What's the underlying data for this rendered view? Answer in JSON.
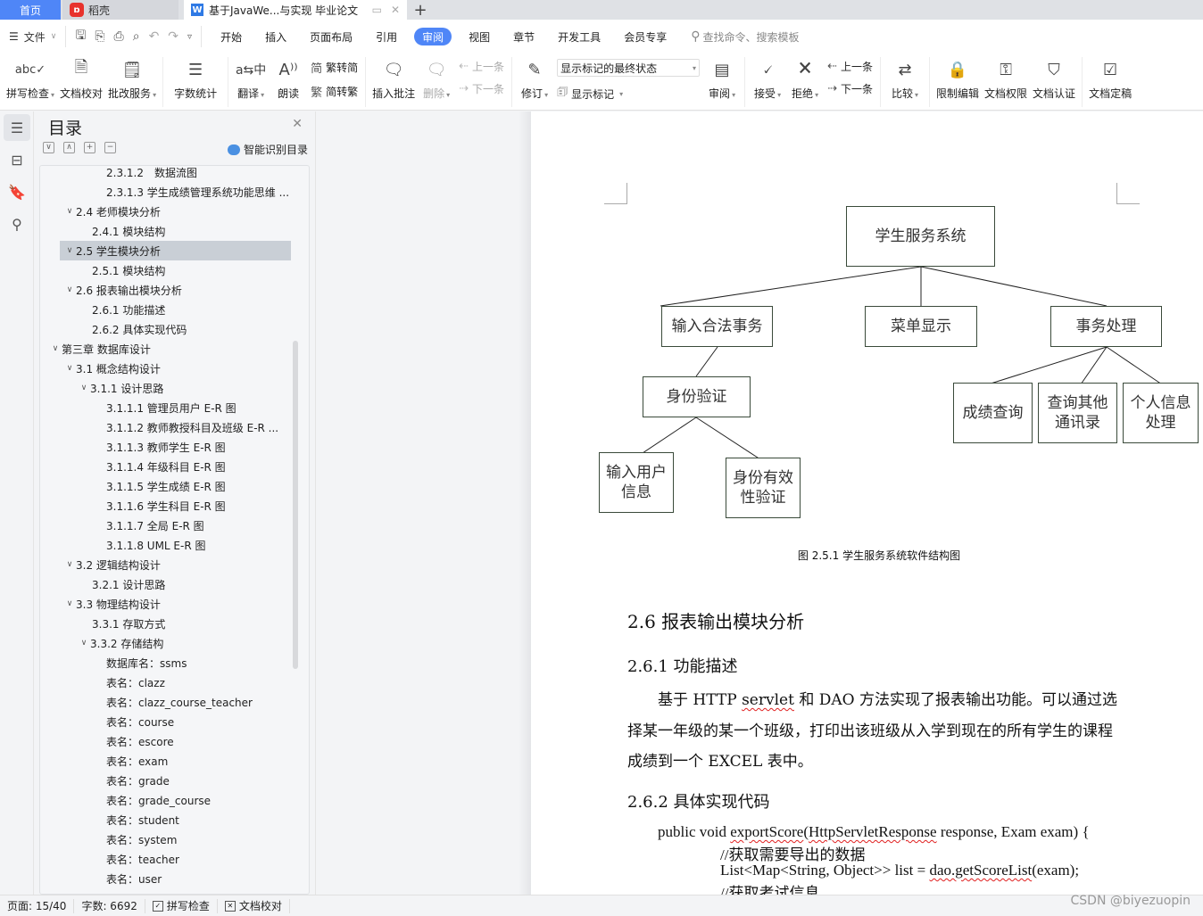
{
  "tabs": {
    "home": "首页",
    "daoke": "稻壳",
    "document": "基于JavaWe...与实现 毕业论文",
    "add": "+"
  },
  "menubar": {
    "file": "文件",
    "ribbon_tabs": [
      "开始",
      "插入",
      "页面布局",
      "引用",
      "审阅",
      "视图",
      "章节",
      "开发工具",
      "会员专享"
    ],
    "active_tab": "审阅",
    "search_placeholder": "查找命令、搜索模板"
  },
  "ribbon": {
    "spell_check": "拼写检查",
    "doc_proofread": "文档校对",
    "grading_service": "批改服务",
    "word_count": "字数统计",
    "translate": "翻译",
    "read_aloud": "朗读",
    "trad_to_simp": "繁转简",
    "simp_to_trad": "简转繁",
    "insert_comment": "插入批注",
    "delete": "删除",
    "prev_comment": "上一条",
    "next_comment": "下一条",
    "track_changes": "修订",
    "markup_state": "显示标记的最终状态",
    "show_markup": "显示标记",
    "review": "审阅",
    "accept": "接受",
    "reject": "拒绝",
    "prev_change": "上一条",
    "next_change": "下一条",
    "compare": "比较",
    "restrict_edit": "限制编辑",
    "doc_permission": "文档权限",
    "doc_cert": "文档认证",
    "doc_finalize": "文档定稿"
  },
  "toc": {
    "title": "目录",
    "smart_detect": "智能识别目录",
    "items": [
      {
        "label": "2.3.1.2　数据流图",
        "level": 4,
        "expand": false
      },
      {
        "label": "2.3.1.3  学生成绩管理系统功能思维 ...",
        "level": 4,
        "expand": false
      },
      {
        "label": "2.4 老师模块分析",
        "level": 2,
        "expand": true
      },
      {
        "label": "2.4.1 模块结构",
        "level": 3,
        "expand": false
      },
      {
        "label": "2.5 学生模块分析",
        "level": 2,
        "expand": true,
        "selected": true
      },
      {
        "label": "2.5.1 模块结构",
        "level": 3,
        "expand": false
      },
      {
        "label": "2.6 报表输出模块分析",
        "level": 2,
        "expand": true
      },
      {
        "label": "2.6.1 功能描述",
        "level": 3,
        "expand": false
      },
      {
        "label": "2.6.2 具体实现代码",
        "level": 3,
        "expand": false
      },
      {
        "label": "第三章  数据库设计",
        "level": 1,
        "expand": true
      },
      {
        "label": "3.1 概念结构设计",
        "level": 2,
        "expand": true
      },
      {
        "label": "3.1.1 设计思路",
        "level": 3,
        "expand": true
      },
      {
        "label": "3.1.1.1  管理员用户 E-R 图",
        "level": 4,
        "expand": false
      },
      {
        "label": "3.1.1.2  教师教授科目及班级 E-R ...",
        "level": 4,
        "expand": false
      },
      {
        "label": "3.1.1.3  教师学生 E-R 图",
        "level": 4,
        "expand": false
      },
      {
        "label": "3.1.1.4  年级科目 E-R 图",
        "level": 4,
        "expand": false
      },
      {
        "label": "3.1.1.5  学生成绩 E-R 图",
        "level": 4,
        "expand": false
      },
      {
        "label": "3.1.1.6  学生科目 E-R 图",
        "level": 4,
        "expand": false
      },
      {
        "label": "3.1.1.7  全局 E-R 图",
        "level": 4,
        "expand": false
      },
      {
        "label": "3.1.1.8 UML E-R 图",
        "level": 4,
        "expand": false
      },
      {
        "label": "3.2 逻辑结构设计",
        "level": 2,
        "expand": true
      },
      {
        "label": "3.2.1 设计思路",
        "level": 3,
        "expand": false
      },
      {
        "label": "3.3 物理结构设计",
        "level": 2,
        "expand": true
      },
      {
        "label": "3.3.1 存取方式",
        "level": 3,
        "expand": false
      },
      {
        "label": "3.3.2 存储结构",
        "level": 3,
        "expand": true
      },
      {
        "label": "数据库名：ssms",
        "level": 4,
        "expand": false
      },
      {
        "label": "表名：clazz",
        "level": 4,
        "expand": false
      },
      {
        "label": "表名：clazz_course_teacher",
        "level": 4,
        "expand": false
      },
      {
        "label": "表名：course",
        "level": 4,
        "expand": false
      },
      {
        "label": "表名：escore",
        "level": 4,
        "expand": false
      },
      {
        "label": "表名：exam",
        "level": 4,
        "expand": false
      },
      {
        "label": "表名：grade",
        "level": 4,
        "expand": false
      },
      {
        "label": "表名：grade_course",
        "level": 4,
        "expand": false
      },
      {
        "label": "表名：student",
        "level": 4,
        "expand": false
      },
      {
        "label": "表名：system",
        "level": 4,
        "expand": false
      },
      {
        "label": "表名：teacher",
        "level": 4,
        "expand": false
      },
      {
        "label": "表名：user",
        "level": 4,
        "expand": false
      }
    ]
  },
  "document": {
    "diagram": {
      "root": "学生服务系统",
      "level1": [
        "输入合法事务",
        "菜单显示",
        "事务处理"
      ],
      "identity": "身份验证",
      "input_user": "输入用户信息",
      "identity_valid": "身份有效性验证",
      "score_query": "成绩查询",
      "query_contacts": "查询其他通讯录",
      "personal_info": "个人信息处理"
    },
    "caption": "图 2.5.1 学生服务系统软件结构图",
    "h2": "2.6 报表输出模块分析",
    "h3_1": "2.6.1 功能描述",
    "para": {
      "p1": "　　基于 HTTP ",
      "p1_wavy": "servlet",
      "p1_rest": " 和 DAO  方法实现了报表输出功能。可以通过选择某一年级的某一个班级，打印出该班级从入学到现在的所有学生的课程成绩到一个 EXCEL 表中。"
    },
    "h3_2": "2.6.2 具体实现代码",
    "code": {
      "l1_a": "public void ",
      "l1_wavy1": "exportScore",
      "l1_b": "(",
      "l1_wavy2": "HttpServletResponse",
      "l1_c": " response, Exam exam) {",
      "l2": "//获取需要导出的数据",
      "l3_a": "List<Map<String, Object>> list = ",
      "l3_wavy": "dao.getScoreList",
      "l3_b": "(exam);",
      "l4": "//获取考试信息"
    }
  },
  "statusbar": {
    "page": "页面: 15/40",
    "word_count": "字数: 6692",
    "spell_check": "拼写检查",
    "doc_proofread": "文档校对"
  },
  "watermark": "CSDN @biyezuopin"
}
